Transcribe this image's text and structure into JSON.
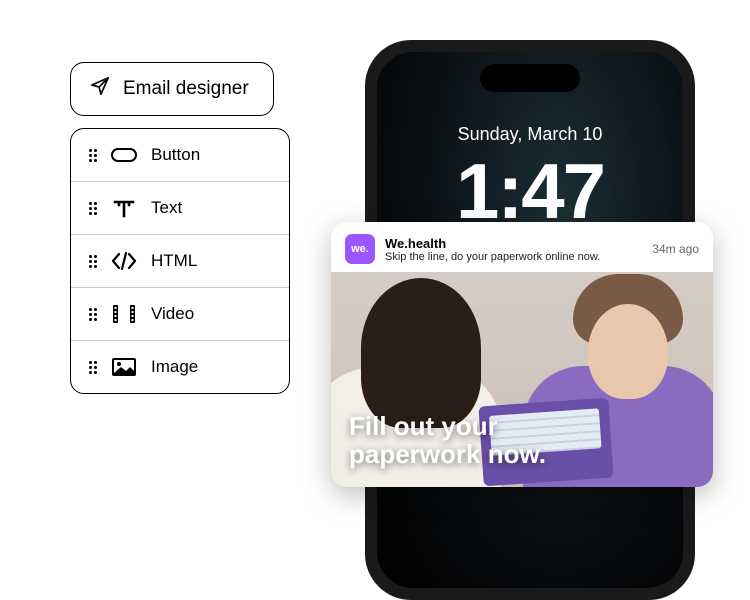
{
  "designer": {
    "label": "Email designer"
  },
  "components": [
    {
      "name": "button",
      "label": "Button"
    },
    {
      "name": "text",
      "label": "Text"
    },
    {
      "name": "html",
      "label": "HTML"
    },
    {
      "name": "video",
      "label": "Video"
    },
    {
      "name": "image",
      "label": "Image"
    }
  ],
  "phone": {
    "date": "Sunday, March 10",
    "time": "1:47"
  },
  "notification": {
    "app_icon_text": "we.",
    "app_name": "We.health",
    "body": "Skip the line, do your paperwork online now.",
    "time": "34m ago",
    "overlay": "Fill out your\npaperwork now."
  }
}
